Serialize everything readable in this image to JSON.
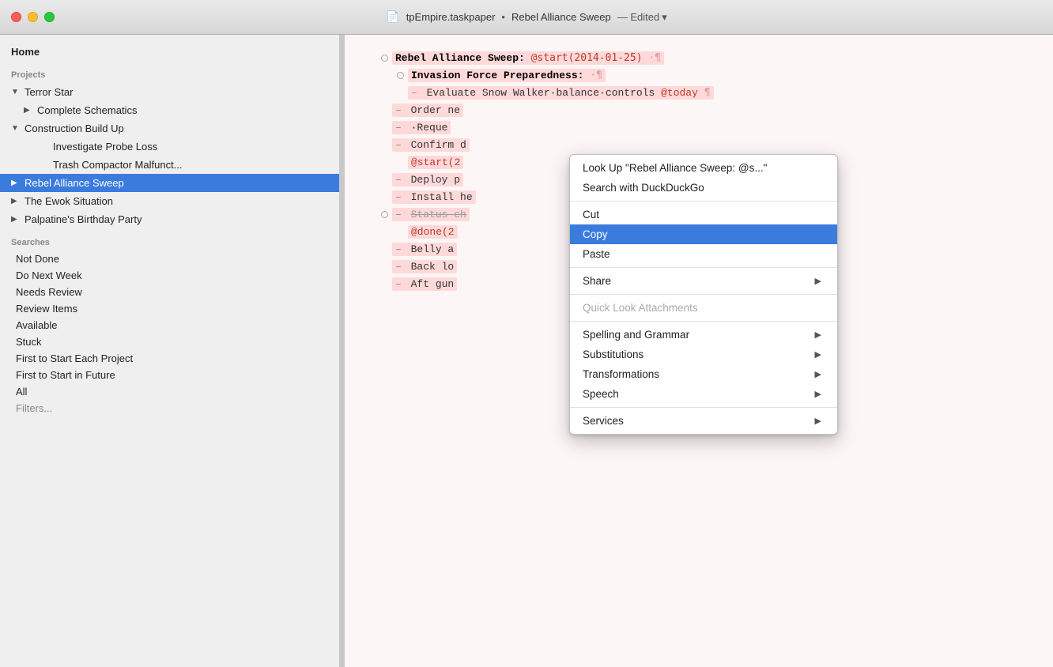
{
  "titlebar": {
    "title": "tpEmpire.taskpaper",
    "subtitle": "Rebel Alliance Sweep",
    "edited_label": "— Edited",
    "chevron": "▾"
  },
  "sidebar": {
    "home_label": "Home",
    "projects_header": "Projects",
    "searches_header": "Searches",
    "projects": [
      {
        "id": "terror-star",
        "label": "Terror Star",
        "indent": 0,
        "arrow": "▼",
        "has_arrow": true
      },
      {
        "id": "complete-schematics",
        "label": "Complete Schematics",
        "indent": 1,
        "arrow": "▶",
        "has_arrow": true
      },
      {
        "id": "construction-build-up",
        "label": "Construction Build Up",
        "indent": 0,
        "arrow": "▼",
        "has_arrow": true
      },
      {
        "id": "investigate-probe-loss",
        "label": "Investigate Probe Loss",
        "indent": 1,
        "arrow": "",
        "has_arrow": false
      },
      {
        "id": "trash-compactor",
        "label": "Trash Compactor Malfunct...",
        "indent": 1,
        "arrow": "",
        "has_arrow": false
      },
      {
        "id": "rebel-alliance-sweep",
        "label": "Rebel Alliance Sweep",
        "indent": 0,
        "arrow": "▶",
        "has_arrow": true,
        "selected": true
      },
      {
        "id": "the-ewok-situation",
        "label": "The Ewok Situation",
        "indent": 0,
        "arrow": "▶",
        "has_arrow": true
      },
      {
        "id": "palpatines-birthday",
        "label": "Palpatine's Birthday Party",
        "indent": 0,
        "arrow": "▶",
        "has_arrow": true
      }
    ],
    "searches": [
      {
        "id": "not-done",
        "label": "Not Done"
      },
      {
        "id": "do-next-week",
        "label": "Do Next Week"
      },
      {
        "id": "needs-review",
        "label": "Needs Review"
      },
      {
        "id": "review-items",
        "label": "Review Items"
      },
      {
        "id": "available",
        "label": "Available"
      },
      {
        "id": "stuck",
        "label": "Stuck"
      },
      {
        "id": "first-to-start-each",
        "label": "First to Start Each Project"
      },
      {
        "id": "first-to-start-future",
        "label": "First to Start in Future"
      },
      {
        "id": "all",
        "label": "All"
      },
      {
        "id": "filters",
        "label": "Filters..."
      }
    ]
  },
  "editor": {
    "lines": [
      {
        "id": "rebel-alliance-sweep-header",
        "type": "project",
        "bullet": "circle",
        "text": "Rebel Alliance Sweep:",
        "tag": "@start(2014-01-25)",
        "pilcrow": "¶",
        "highlighted": true
      },
      {
        "id": "invasion-force",
        "type": "project",
        "bullet": "circle",
        "text": "Invasion Force Preparedness:",
        "pilcrow": "¶",
        "highlighted": true
      },
      {
        "id": "evaluate-snow-walker",
        "type": "task",
        "indent": 1,
        "dash": true,
        "text": "Evaluate Snow Walker balance controls",
        "tag": "@today",
        "pilcrow": "¶",
        "highlighted": true
      },
      {
        "id": "order-new",
        "type": "task",
        "indent": 0,
        "dash": true,
        "text": "Order ne",
        "truncated": true,
        "highlighted": true
      },
      {
        "id": "reque",
        "type": "task",
        "indent": 1,
        "dash": true,
        "text": "Reque",
        "truncated": true,
        "highlighted": true
      },
      {
        "id": "confirm",
        "type": "task",
        "indent": 0,
        "dash": true,
        "text": "Confirm d",
        "truncated": true,
        "highlighted": true
      },
      {
        "id": "start-tag",
        "type": "tag-line",
        "indent": 1,
        "text": "@start(2",
        "truncated": true,
        "highlighted": true
      },
      {
        "id": "deploy",
        "type": "task",
        "indent": 0,
        "dash": true,
        "text": "Deploy p",
        "truncated": true,
        "highlighted": true
      },
      {
        "id": "install",
        "type": "task",
        "indent": 0,
        "dash": true,
        "text": "Install he",
        "truncated": true,
        "highlighted": true
      },
      {
        "id": "status-ch",
        "type": "task",
        "indent": 0,
        "dash": true,
        "text": "Status ch",
        "truncated": true,
        "strikethrough": true,
        "highlighted": true
      },
      {
        "id": "done-tag",
        "type": "tag-line",
        "indent": 1,
        "text": "@done(2",
        "truncated": true,
        "highlighted": true
      },
      {
        "id": "belly",
        "type": "task",
        "indent": 0,
        "dash": true,
        "text": "Belly a",
        "truncated": true,
        "highlighted": true
      },
      {
        "id": "back",
        "type": "task",
        "indent": 0,
        "dash": true,
        "text": "Back lo",
        "truncated": true,
        "highlighted": true
      },
      {
        "id": "aft-gun",
        "type": "task",
        "indent": 0,
        "dash": true,
        "text": "Aft gun",
        "truncated": true,
        "highlighted": true
      }
    ]
  },
  "context_menu": {
    "items": [
      {
        "id": "look-up",
        "label": "Look Up \"Rebel Alliance Sweep: @s...\"",
        "disabled": false,
        "has_arrow": false,
        "separator_after": true
      },
      {
        "id": "search-duckduckgo",
        "label": "Search with DuckDuckGo",
        "disabled": false,
        "has_arrow": false,
        "separator_after": true
      },
      {
        "id": "cut",
        "label": "Cut",
        "disabled": false,
        "has_arrow": false,
        "separator_after": false
      },
      {
        "id": "copy",
        "label": "Copy",
        "disabled": false,
        "has_arrow": false,
        "highlighted": true,
        "separator_after": false
      },
      {
        "id": "paste",
        "label": "Paste",
        "disabled": false,
        "has_arrow": false,
        "separator_after": true
      },
      {
        "id": "share",
        "label": "Share",
        "disabled": false,
        "has_arrow": true,
        "separator_after": true
      },
      {
        "id": "quick-look",
        "label": "Quick Look Attachments",
        "disabled": true,
        "has_arrow": false,
        "separator_after": true
      },
      {
        "id": "spelling-grammar",
        "label": "Spelling and Grammar",
        "disabled": false,
        "has_arrow": true,
        "separator_after": false
      },
      {
        "id": "substitutions",
        "label": "Substitutions",
        "disabled": false,
        "has_arrow": true,
        "separator_after": false
      },
      {
        "id": "transformations",
        "label": "Transformations",
        "disabled": false,
        "has_arrow": true,
        "separator_after": false
      },
      {
        "id": "speech",
        "label": "Speech",
        "disabled": false,
        "has_arrow": true,
        "separator_after": true
      },
      {
        "id": "services",
        "label": "Services",
        "disabled": false,
        "has_arrow": true,
        "separator_after": false
      }
    ]
  }
}
